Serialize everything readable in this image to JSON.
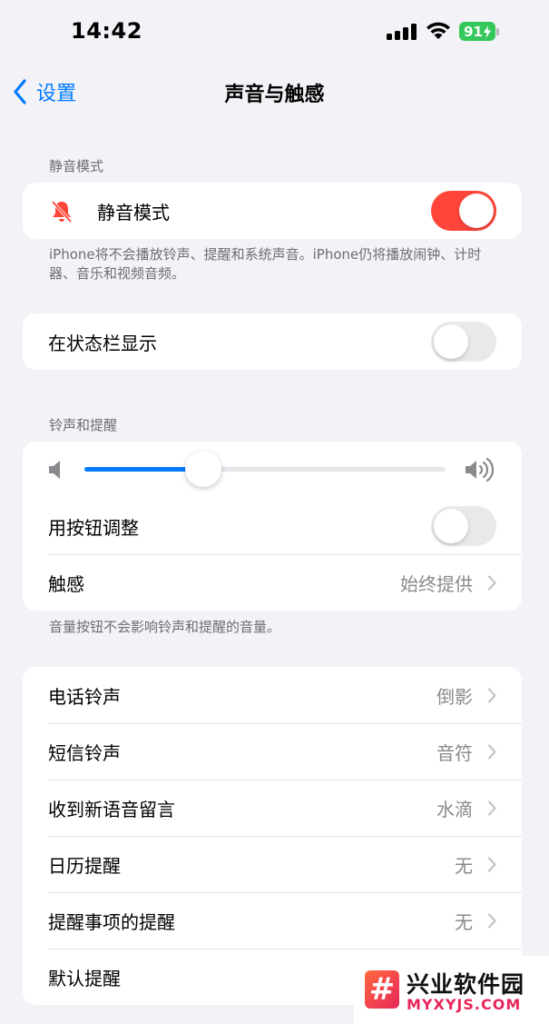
{
  "status_bar": {
    "time": "14:42",
    "battery": "91"
  },
  "nav": {
    "back_label": "设置",
    "title": "声音与触感"
  },
  "silent_section": {
    "header": "静音模式",
    "label": "静音模式",
    "on": true,
    "footer": "iPhone将不会播放铃声、提醒和系统声音。iPhone仍将播放闹钟、计时器、音乐和视频音频。"
  },
  "status_bar_row": {
    "label": "在状态栏显示",
    "on": false
  },
  "ringtone_section": {
    "header": "铃声和提醒",
    "volume_fraction": 0.33,
    "adjust_label": "用按钮调整",
    "adjust_on": false,
    "haptics_label": "触感",
    "haptics_value": "始终提供",
    "footer": "音量按钮不会影响铃声和提醒的音量。"
  },
  "sounds_section": {
    "rows": [
      {
        "label": "电话铃声",
        "value": "倒影"
      },
      {
        "label": "短信铃声",
        "value": "音符"
      },
      {
        "label": "收到新语音留言",
        "value": "水滴"
      },
      {
        "label": "日历提醒",
        "value": "无"
      },
      {
        "label": "提醒事项的提醒",
        "value": "无"
      },
      {
        "label": "默认提醒",
        "value": ""
      }
    ]
  },
  "watermark": {
    "logo_glyph": "#",
    "name": "兴业软件园",
    "url": "MYXYJS.COM"
  },
  "colors": {
    "accent": "#007aff",
    "toggle_on": "#ff453a",
    "battery": "#34c759"
  }
}
